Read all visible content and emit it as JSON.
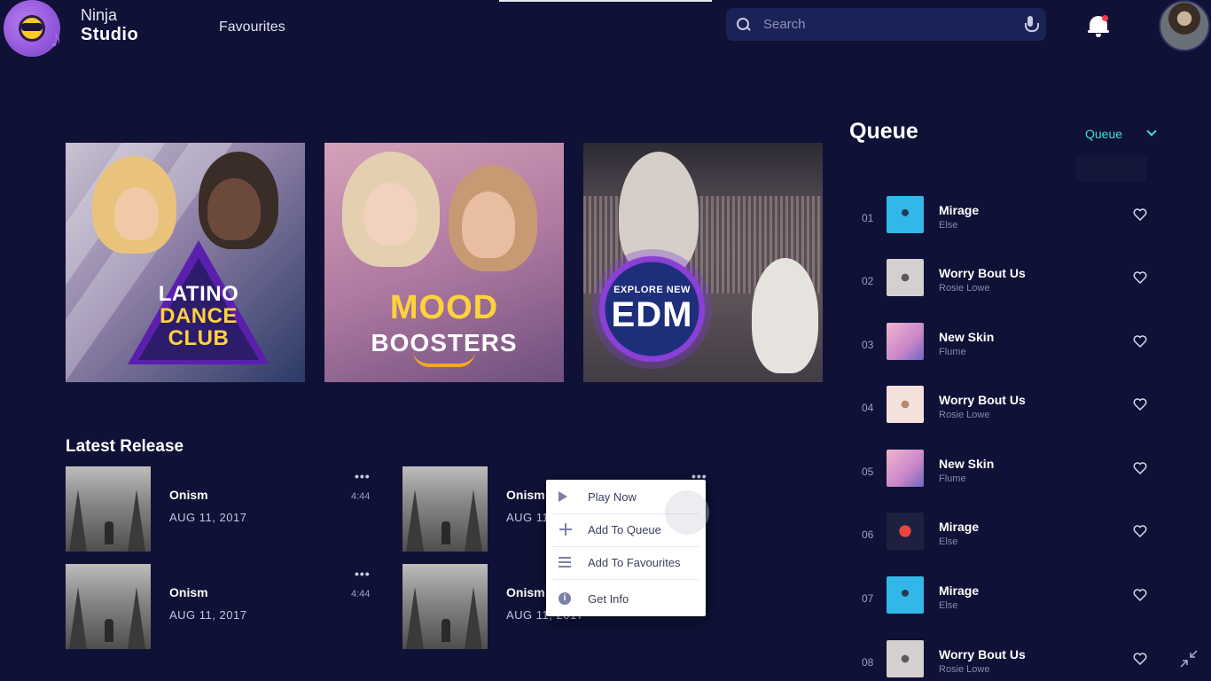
{
  "header": {
    "brand_line1": "Ninja",
    "brand_line2": "Studio",
    "nav_favourites": "Favourites",
    "search_placeholder": "Search",
    "notification_dot_color": "#ff3b4e"
  },
  "featured": [
    {
      "lines": [
        "LATINO",
        "DANCE",
        "CLUB"
      ]
    },
    {
      "lines": [
        "MOOD",
        "BOOSTERS"
      ]
    },
    {
      "lines": [
        "EXPLORE NEW",
        "EDM"
      ]
    }
  ],
  "latest": {
    "title": "Latest Release",
    "items": [
      {
        "title": "Onism",
        "date": "AUG 11, 2017",
        "more": "•••",
        "duration": "4:44"
      },
      {
        "title": "Onism",
        "date": "AUG 11,",
        "more": "•••",
        "duration": ""
      },
      {
        "title": "Onism",
        "date": "AUG 11, 2017",
        "more": "•••",
        "duration": "4:44"
      },
      {
        "title": "Onism",
        "date": "AUG 11, 2017",
        "more": "",
        "duration": ""
      }
    ]
  },
  "context_menu": {
    "items": [
      "Play Now",
      "Add To Queue",
      "Add To Favourites",
      "Get Info"
    ],
    "info_glyph": "i"
  },
  "queue": {
    "title": "Queue",
    "filter": "Queue",
    "accent_color": "#3fe0cf",
    "items": [
      {
        "num": "01",
        "title": "Mirage",
        "artist": "Else",
        "thumb": "blue"
      },
      {
        "num": "02",
        "title": "Worry Bout Us",
        "artist": "Rosie Lowe",
        "thumb": "grey"
      },
      {
        "num": "03",
        "title": "New Skin",
        "artist": "Flume",
        "thumb": "pink"
      },
      {
        "num": "04",
        "title": "Worry Bout Us",
        "artist": "Rosie Lowe",
        "thumb": "cream"
      },
      {
        "num": "05",
        "title": "New Skin",
        "artist": "Flume",
        "thumb": "pink"
      },
      {
        "num": "06",
        "title": "Mirage",
        "artist": "Else",
        "thumb": "dark"
      },
      {
        "num": "07",
        "title": "Mirage",
        "artist": "Else",
        "thumb": "blue"
      },
      {
        "num": "08",
        "title": "Worry Bout Us",
        "artist": "Rosie Lowe",
        "thumb": "grey"
      }
    ]
  }
}
